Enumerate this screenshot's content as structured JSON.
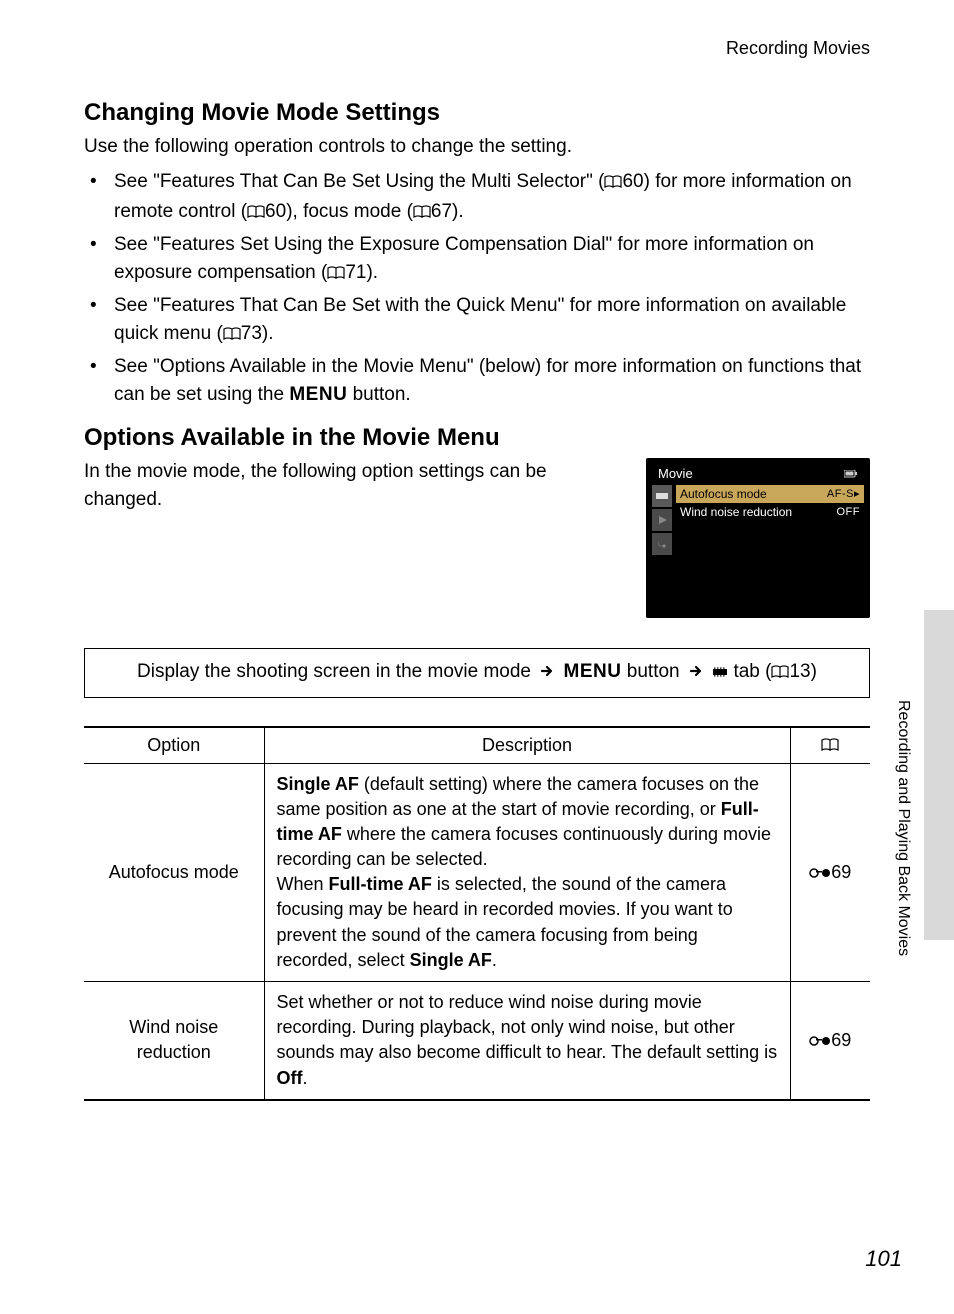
{
  "header": {
    "section": "Recording Movies"
  },
  "h1": "Changing Movie Mode Settings",
  "intro1": "Use the following operation controls to change the setting.",
  "bullets": [
    {
      "pre": "See \"Features That Can Be Set Using the Multi Selector\" (",
      "ref1": "60",
      "mid1": ") for more information on remote control (",
      "ref2": "60",
      "mid2": "), focus mode (",
      "ref3": "67",
      "post": ")."
    },
    {
      "pre": "See \"Features Set Using the Exposure Compensation Dial\" for more information on exposure compensation (",
      "ref1": "71",
      "post": ")."
    },
    {
      "pre": "See \"Features That Can Be Set with the Quick Menu\" for more information on available quick menu (",
      "ref1": "73",
      "post": ")."
    },
    {
      "pre": "See \"Options Available in the Movie Menu\" (below) for more information on functions that can be set using the ",
      "menu": "MENU",
      "post": " button."
    }
  ],
  "h2": "Options Available in the Movie Menu",
  "intro2": "In the movie mode, the following option settings can be changed.",
  "lcd": {
    "title": "Movie",
    "items": [
      {
        "label": "Autofocus mode",
        "value": "AF-S",
        "selected": true
      },
      {
        "label": "Wind noise reduction",
        "value": "OFF",
        "selected": false
      }
    ]
  },
  "navbox": {
    "pre": "Display the shooting screen in the movie mode ",
    "menu": "MENU",
    "mid": " button ",
    "tab_label": " tab (",
    "ref": "13",
    "post": ")"
  },
  "table": {
    "headers": [
      "Option",
      "Description",
      ""
    ],
    "rows": [
      {
        "option": "Autofocus mode",
        "desc_parts": {
          "b1": "Single AF",
          "t1": " (default setting) where the camera focuses on the same position as one at the start of movie recording, or ",
          "b2": "Full-time AF",
          "t2": " where the camera focuses continuously during movie recording can be selected.",
          "br": true,
          "t3": "When ",
          "b3": "Full-time AF",
          "t4": " is selected, the sound of the camera focusing may be heard in recorded movies. If you want to prevent the sound of the camera focusing from being recorded, select ",
          "b4": "Single AF",
          "t5": "."
        },
        "ref": "69"
      },
      {
        "option": "Wind noise reduction",
        "desc_parts": {
          "t1": "Set whether or not to reduce wind noise during movie recording. During playback, not only wind noise, but other sounds may also become difficult to hear. The default setting is ",
          "b1": "Off",
          "t2": "."
        },
        "ref": "69"
      }
    ]
  },
  "side_text": "Recording and Playing Back Movies",
  "page_number": "101"
}
